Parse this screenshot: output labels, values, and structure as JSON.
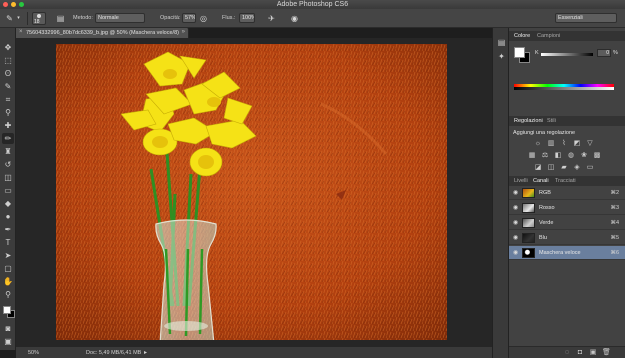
{
  "window": {
    "title": "Adobe Photoshop CS6",
    "traffic_light_colors": [
      "#ff5f57",
      "#febc2e",
      "#28c840"
    ]
  },
  "options_bar": {
    "brush_size": "18",
    "mode_label": "Metodo:",
    "mode_value": "Normale",
    "opacity_label": "Opacità:",
    "opacity_value": "57%",
    "flow_label": "Flus.:",
    "flow_value": "100%",
    "workspace": "Essenziali"
  },
  "document": {
    "tab_title": "75604332996_80b7dc6339_b.jpg @ 50% (Maschera veloce/8)",
    "close_glyph": "×",
    "menu_glyph": "»"
  },
  "status_bar": {
    "zoom": "50%",
    "doc_info": "Doc: 5,49 MB/6,41 MB"
  },
  "color_panel": {
    "tabs": [
      "Colore",
      "Campioni"
    ],
    "channel_label": "K",
    "channel_value": "0",
    "percent": "%",
    "foreground_color": "#ffffff",
    "background_color": "#000000"
  },
  "adjustments_panel": {
    "tabs": [
      "Regolazioni",
      "Stili"
    ],
    "title": "Aggiungi una regolazione",
    "row1_icons": [
      "brightness-icon",
      "levels-icon",
      "curves-icon",
      "exposure-icon",
      "vibrance-icon"
    ],
    "row2_icons": [
      "hue-saturation-icon",
      "color-balance-icon",
      "black-white-icon",
      "photo-filter-icon",
      "channel-mixer-icon",
      "color-lookup-icon"
    ],
    "row3_icons": [
      "invert-icon",
      "posterize-icon",
      "threshold-icon",
      "selective-color-icon",
      "gradient-map-icon"
    ]
  },
  "layers_panel": {
    "tabs": [
      "Livelli",
      "Canali",
      "Tracciati"
    ],
    "active_tab": "Canali",
    "channels": [
      {
        "name": "RGB",
        "shortcut": "⌘2",
        "selected": false
      },
      {
        "name": "Rosso",
        "shortcut": "⌘3",
        "selected": false
      },
      {
        "name": "Verde",
        "shortcut": "⌘4",
        "selected": false
      },
      {
        "name": "Blu",
        "shortcut": "⌘5",
        "selected": false
      },
      {
        "name": "Maschera veloce",
        "shortcut": "⌘6",
        "selected": true
      }
    ]
  }
}
